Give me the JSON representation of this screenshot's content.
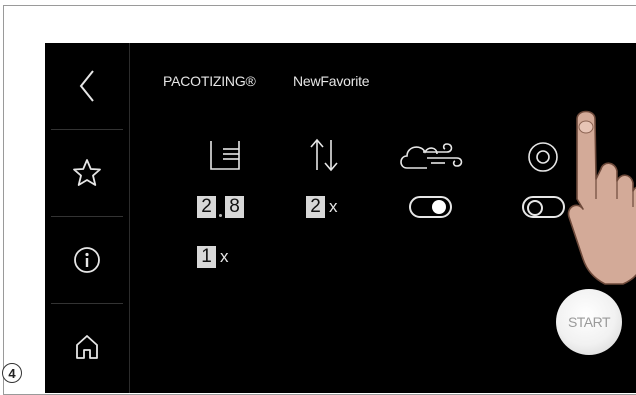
{
  "step_number": "4",
  "header": {
    "mode": "PACOTIZING®",
    "favorite_name": "NewFavorite"
  },
  "sidebar": {
    "items": [
      {
        "icon": "back-icon"
      },
      {
        "icon": "star-icon"
      },
      {
        "icon": "info-icon"
      },
      {
        "icon": "home-icon"
      }
    ]
  },
  "params": {
    "portions": {
      "digits": [
        "2",
        "8"
      ]
    },
    "repeat": {
      "digit": "2",
      "suffix": "x"
    },
    "air_boost": {
      "on": true
    },
    "fourth": {
      "on": false
    },
    "second_row": {
      "digit": "1",
      "suffix": "x"
    }
  },
  "start_button": {
    "label": "START"
  },
  "colors": {
    "screen_bg": "#000000",
    "accent": "#d0263a",
    "text": "#e6e6e6"
  }
}
